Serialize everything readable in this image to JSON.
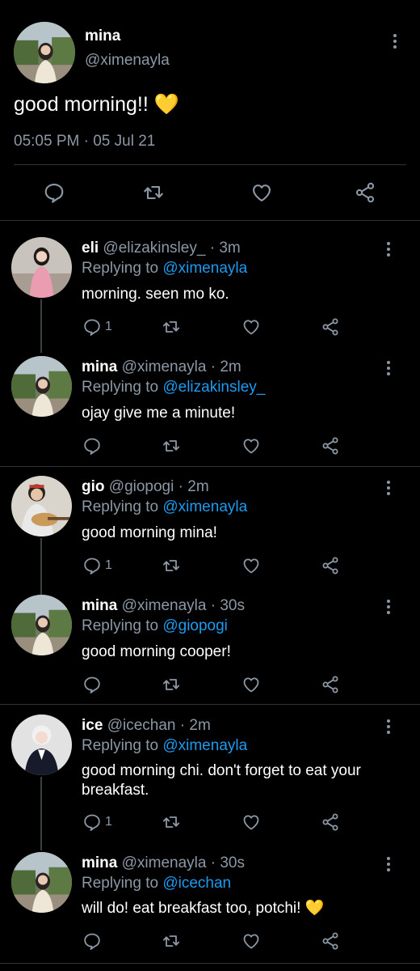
{
  "main_tweet": {
    "name": "mina",
    "handle": "@ximenayla",
    "text": "good morning!!",
    "emoji": "💛",
    "time": "05:05 PM",
    "dot": "·",
    "date": "05 Jul 21"
  },
  "replies": [
    {
      "name": "eli",
      "handle": "@elizakinsley_",
      "dot": "·",
      "time": "3m",
      "replying_prefix": "Replying to",
      "replying_to": "@ximenayla",
      "text": "morning. seen mo ko.",
      "reply_count": "1"
    },
    {
      "name": "mina",
      "handle": "@ximenayla",
      "dot": "·",
      "time": "2m",
      "replying_prefix": "Replying to",
      "replying_to": "@elizakinsley_",
      "text": "ojay give me a minute!",
      "reply_count": ""
    },
    {
      "name": "gio",
      "handle": "@giopogi",
      "dot": "·",
      "time": "2m",
      "replying_prefix": "Replying to",
      "replying_to": "@ximenayla",
      "text": "good morning mina!",
      "reply_count": "1"
    },
    {
      "name": "mina",
      "handle": "@ximenayla",
      "dot": "·",
      "time": "30s",
      "replying_prefix": "Replying to",
      "replying_to": "@giopogi",
      "text": "good morning cooper!",
      "reply_count": ""
    },
    {
      "name": "ice",
      "handle": "@icechan",
      "dot": "·",
      "time": "2m",
      "replying_prefix": "Replying to",
      "replying_to": "@ximenayla",
      "text": "good morning chi. don't forget to eat your breakfast.",
      "reply_count": "1"
    },
    {
      "name": "mina",
      "handle": "@ximenayla",
      "dot": "·",
      "time": "30s",
      "replying_prefix": "Replying to",
      "replying_to": "@icechan",
      "text": "will do! eat breakfast too, potchi!",
      "emoji": "💛",
      "reply_count": ""
    }
  ],
  "colors": {
    "background": "#000000",
    "text": "#ffffff",
    "secondary": "#8b98a5",
    "link": "#1d9bf0",
    "divider": "#2f3336"
  },
  "icons": [
    "comment-icon",
    "retweet-icon",
    "like-icon",
    "share-icon",
    "more-icon"
  ]
}
